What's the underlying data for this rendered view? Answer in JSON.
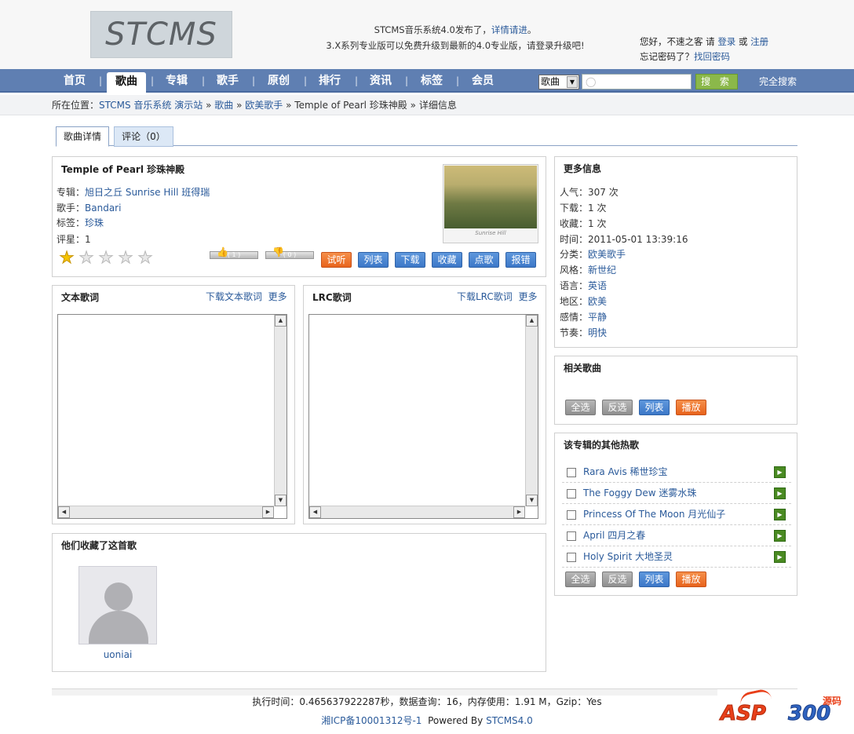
{
  "header": {
    "logo": "STCMS",
    "announce1_text": "STCMS音乐系统4.0发布了，",
    "announce1_link": "详情请进",
    "announce1_end": "。",
    "announce2": "3.X系列专业版可以免费升级到最新的4.0专业版，请登录升级吧!",
    "user_greeting": "您好，不速之客  请",
    "login": "登录",
    "or": "或",
    "register": "注册",
    "forgot": "忘记密码了？",
    "recover": "找回密码"
  },
  "nav": {
    "items": [
      "首页",
      "歌曲",
      "专辑",
      "歌手",
      "原创",
      "排行",
      "资讯",
      "标签",
      "会员"
    ],
    "active_index": 1,
    "search_select": "歌曲",
    "search_button": "搜 索",
    "advanced_search": "完全搜索"
  },
  "breadcrumb": {
    "prefix": "所在位置：",
    "site": "STCMS 音乐系统 演示站",
    "sep": "»",
    "level1": "歌曲",
    "level2": "欧美歌手",
    "song": "Temple of Pearl 珍珠神殿",
    "page": "详细信息"
  },
  "tabs": [
    {
      "label": "歌曲详情",
      "active": true
    },
    {
      "label": "评论（0）",
      "active": false
    }
  ],
  "song": {
    "title": "Temple of Pearl 珍珠神殿",
    "album_label": "专辑：",
    "album": "旭日之丘  Sunrise Hill 班得瑞",
    "singer_label": "歌手：",
    "singer": "Bandari",
    "tag_label": "标签：",
    "tag": "珍珠",
    "rating_label": "评星：",
    "rating": "1",
    "stars_filled": 1,
    "stars_total": 5,
    "cover_caption": "Sunrise Hill",
    "like_count": "( 1 )",
    "dislike_count": "( 0 )",
    "actions": [
      "试听",
      "列表",
      "下载",
      "收藏",
      "点歌",
      "报错"
    ]
  },
  "more_info": {
    "title": "更多信息",
    "rows": [
      {
        "label": "人气：",
        "value": "307 次",
        "link": false
      },
      {
        "label": "下载：",
        "value": "1 次",
        "link": false
      },
      {
        "label": "收藏：",
        "value": "1 次",
        "link": false
      },
      {
        "label": "时间：",
        "value": "2011-05-01 13:39:16",
        "link": false
      },
      {
        "label": "分类：",
        "value": "欧美歌手",
        "link": true
      },
      {
        "label": "风格：",
        "value": "新世纪",
        "link": true
      },
      {
        "label": "语言：",
        "value": "英语",
        "link": true
      },
      {
        "label": "地区：",
        "value": "欧美",
        "link": true
      },
      {
        "label": "感情：",
        "value": "平静",
        "link": true
      },
      {
        "label": "节奏：",
        "value": "明快",
        "link": true
      }
    ]
  },
  "lyrics_text": {
    "title": "文本歌词",
    "download": "下载文本歌词",
    "more": "更多"
  },
  "lyrics_lrc": {
    "title": "LRC歌词",
    "download": "下载LRC歌词",
    "more": "更多"
  },
  "related": {
    "title": "相关歌曲",
    "buttons": [
      "全选",
      "反选",
      "列表",
      "播放"
    ]
  },
  "album_hot": {
    "title": "该专辑的其他热歌",
    "songs": [
      "Rara Avis 稀世珍宝",
      "The Foggy Dew 迷雾水珠",
      "Princess Of The Moon 月光仙子",
      "April 四月之春",
      "Holy Spirit 大地圣灵"
    ],
    "buttons": [
      "全选",
      "反选",
      "列表",
      "播放"
    ]
  },
  "collectors": {
    "title": "他们收藏了这首歌",
    "users": [
      "uoniai"
    ]
  },
  "footer": {
    "stats": "执行时间：0.465637922287秒，数据查询：16，内存使用：1.91 M，Gzip：Yes",
    "icp": "湘ICP备10001312号-1",
    "powered_prefix": "Powered By",
    "powered_link": "STCMS4.0"
  },
  "watermark": {
    "part1": "ASP",
    "part2": "300",
    "part3": "源码"
  },
  "colors": {
    "nav_bg": "#5f7fb2",
    "link": "#2a5a9a",
    "btn_blue": "#3c78c8",
    "btn_orange": "#e8631c",
    "btn_gray": "#8f8f8f",
    "search_btn": "#8bb84a"
  }
}
